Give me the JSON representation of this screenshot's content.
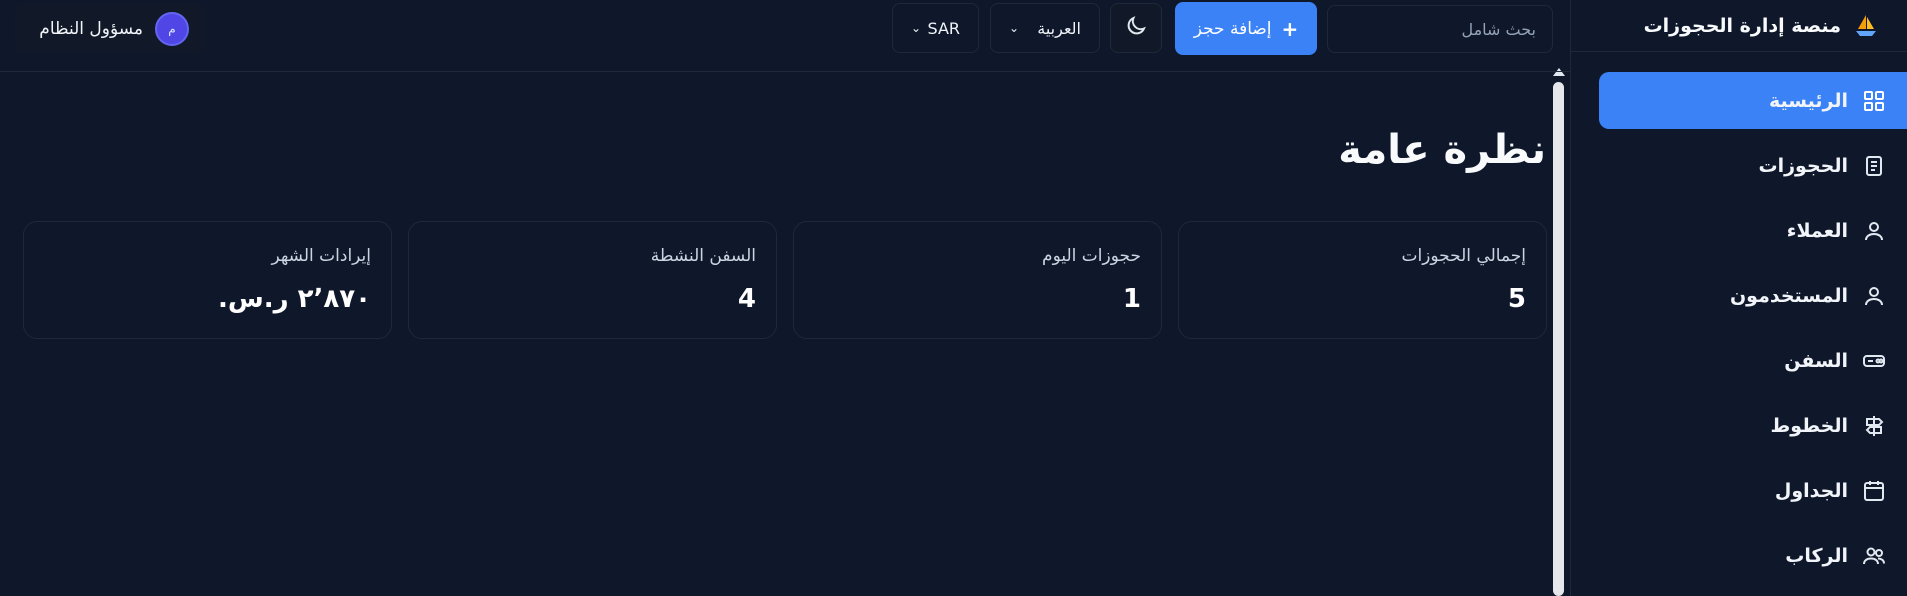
{
  "brand": {
    "title": "منصة إدارة الحجوزات"
  },
  "sidebar": {
    "items": [
      {
        "label": "الرئيسية",
        "icon": "grid-icon",
        "active": true
      },
      {
        "label": "الحجوزات",
        "icon": "receipt-icon",
        "active": false
      },
      {
        "label": "العملاء",
        "icon": "user-icon",
        "active": false
      },
      {
        "label": "المستخدمون",
        "icon": "user-icon",
        "active": false
      },
      {
        "label": "السفن",
        "icon": "ship-icon",
        "active": false
      },
      {
        "label": "الخطوط",
        "icon": "signpost-icon",
        "active": false
      },
      {
        "label": "الجداول",
        "icon": "calendar-icon",
        "active": false
      },
      {
        "label": "الركاب",
        "icon": "users-icon",
        "active": false
      }
    ]
  },
  "header": {
    "search_placeholder": "بحث شامل",
    "add_booking_label": "إضافة حجز",
    "language": "العربية",
    "currency": "SAR",
    "user_name": "مسؤول النظام",
    "user_initial": "م"
  },
  "main": {
    "title": "نظرة عامة",
    "stats": [
      {
        "label": "إجمالي الحجوزات",
        "value": "5"
      },
      {
        "label": "حجوزات اليوم",
        "value": "1"
      },
      {
        "label": "السفن النشطة",
        "value": "4"
      },
      {
        "label": "إيرادات الشهر",
        "value": "٢٬٨٧٠ ر.س."
      }
    ]
  },
  "colors": {
    "accent": "#3b82f6",
    "background": "#0f172a",
    "border": "#1e293b"
  }
}
